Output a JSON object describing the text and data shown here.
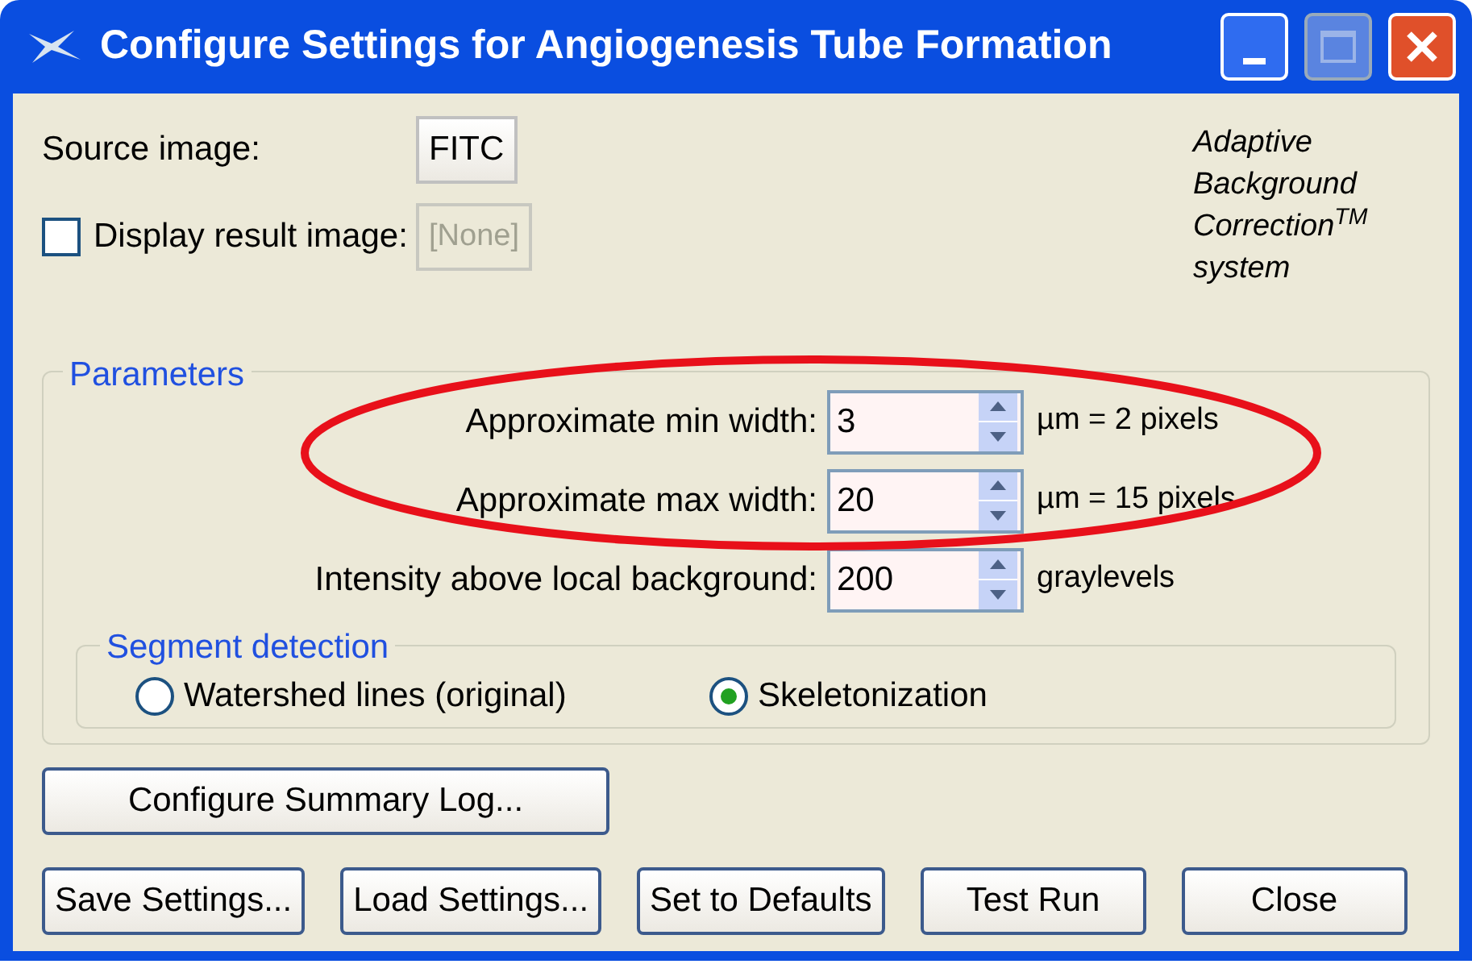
{
  "window": {
    "title": "Configure Settings for Angiogenesis Tube Formation"
  },
  "source_image": {
    "label": "Source image:",
    "button": "FITC"
  },
  "display_result": {
    "label": "Display result image:",
    "checked": false,
    "button": "[None]",
    "button_disabled": true
  },
  "brand_note": {
    "lines": [
      "Adaptive",
      "Background",
      "Correction$^{TM}$",
      "system"
    ]
  },
  "parameters": {
    "title": "Parameters",
    "fields": [
      {
        "label": "Approximate min width:",
        "value": "3",
        "unit": "µm = 2 pixels"
      },
      {
        "label": "Approximate max width:",
        "value": "20",
        "unit": "µm = 15 pixels"
      },
      {
        "label": "Intensity above local background:",
        "value": "200",
        "unit": "graylevels"
      }
    ],
    "segment_detection": {
      "title": "Segment detection",
      "options": [
        {
          "label": "Watershed lines (original)",
          "selected": false
        },
        {
          "label": "Skeletonization",
          "selected": true
        }
      ]
    }
  },
  "summary_button": "Configure Summary Log...",
  "buttons": [
    "Save Settings...",
    "Load Settings...",
    "Set to Defaults",
    "Test Run",
    "Close"
  ]
}
